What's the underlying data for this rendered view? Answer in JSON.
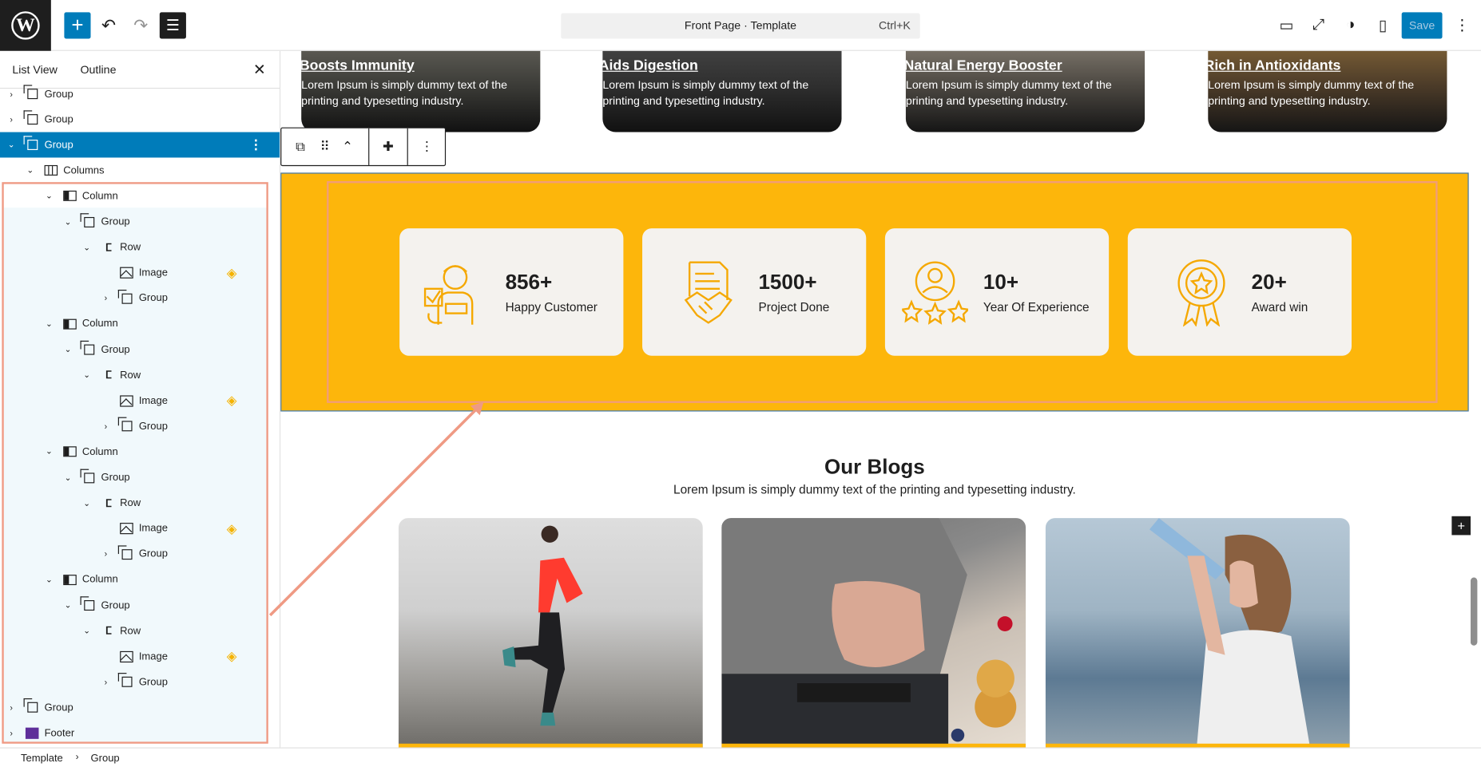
{
  "topbar": {
    "logo": "W",
    "add_icon": "+",
    "undo_icon": "↶",
    "redo_icon": "↷",
    "list_icon": "☰",
    "command_title": "Front Page · Template",
    "command_shortcut": "Ctrl+K",
    "save_label": "Save",
    "icons": [
      "desktop-icon",
      "fullscreen-icon",
      "contrast-icon",
      "sidebar-icon",
      "more-icon"
    ],
    "icon_glyphs": [
      "▭",
      "⤢",
      "◑",
      "▯",
      "⋮"
    ]
  },
  "sidebar": {
    "tabs": [
      "List View",
      "Outline"
    ],
    "close_icon": "✕",
    "rows": [
      {
        "label": "Group",
        "icon": "group",
        "chev": "›",
        "indent": 0
      },
      {
        "label": "Group",
        "icon": "group",
        "chev": "›",
        "indent": 0
      },
      {
        "label": "Group",
        "icon": "group",
        "chev": "⌄",
        "indent": 0,
        "selected": true
      },
      {
        "label": "Columns",
        "icon": "cols",
        "chev": "⌄",
        "indent": 1
      },
      {
        "label": "Column",
        "icon": "col",
        "chev": "⌄",
        "indent": 2
      },
      {
        "label": "Group",
        "icon": "group",
        "chev": "⌄",
        "indent": 3
      },
      {
        "label": "Row",
        "icon": "row",
        "chev": "⌄",
        "indent": 4
      },
      {
        "label": "Image",
        "icon": "img",
        "chev": "",
        "indent": 5,
        "thumb": true
      },
      {
        "label": "Group",
        "icon": "group",
        "chev": "›",
        "indent": 5
      },
      {
        "label": "Column",
        "icon": "col",
        "chev": "⌄",
        "indent": 2
      },
      {
        "label": "Group",
        "icon": "group",
        "chev": "⌄",
        "indent": 3
      },
      {
        "label": "Row",
        "icon": "row",
        "chev": "⌄",
        "indent": 4
      },
      {
        "label": "Image",
        "icon": "img",
        "chev": "",
        "indent": 5,
        "thumb": true
      },
      {
        "label": "Group",
        "icon": "group",
        "chev": "›",
        "indent": 5
      },
      {
        "label": "Column",
        "icon": "col",
        "chev": "⌄",
        "indent": 2
      },
      {
        "label": "Group",
        "icon": "group",
        "chev": "⌄",
        "indent": 3
      },
      {
        "label": "Row",
        "icon": "row",
        "chev": "⌄",
        "indent": 4
      },
      {
        "label": "Image",
        "icon": "img",
        "chev": "",
        "indent": 5,
        "thumb": true
      },
      {
        "label": "Group",
        "icon": "group",
        "chev": "›",
        "indent": 5
      },
      {
        "label": "Column",
        "icon": "col",
        "chev": "⌄",
        "indent": 2
      },
      {
        "label": "Group",
        "icon": "group",
        "chev": "⌄",
        "indent": 3
      },
      {
        "label": "Row",
        "icon": "row",
        "chev": "⌄",
        "indent": 4
      },
      {
        "label": "Image",
        "icon": "img",
        "chev": "",
        "indent": 5,
        "thumb": true
      },
      {
        "label": "Group",
        "icon": "group",
        "chev": "›",
        "indent": 5
      },
      {
        "label": "Group",
        "icon": "group",
        "chev": "›",
        "indent": 0
      },
      {
        "label": "Footer",
        "icon": "footer",
        "chev": "›",
        "indent": 0
      }
    ]
  },
  "breadcrumb": {
    "items": [
      "Template",
      "Group"
    ],
    "sep": "›"
  },
  "top_cards": [
    {
      "title": "Boosts Immunity",
      "desc": "Lorem Ipsum is simply dummy text of the printing and typesetting industry."
    },
    {
      "title": "Aids Digestion",
      "desc": "Lorem Ipsum is simply dummy text of the printing and typesetting industry."
    },
    {
      "title": "Natural Energy Booster",
      "desc": "Lorem Ipsum is simply dummy text of the printing and typesetting industry."
    },
    {
      "title": "Rich in Antioxidants",
      "desc": "Lorem Ipsum is simply dummy text of the printing and typesetting industry."
    }
  ],
  "block_toolbar": {
    "icons": [
      "⧉",
      "⠿",
      "⌃",
      "✚",
      "⋮"
    ]
  },
  "stats": [
    {
      "number": "856+",
      "label": "Happy Customer"
    },
    {
      "number": "1500+",
      "label": "Project Done"
    },
    {
      "number": "10+",
      "label": "Year Of Experience"
    },
    {
      "number": "20+",
      "label": "Award win"
    }
  ],
  "blogs": {
    "title": "Our Blogs",
    "subtitle": "Lorem Ipsum is simply dummy text of the printing and typesetting industry."
  },
  "colors": {
    "accent": "#007cba",
    "brand_yellow": "#fdb60b",
    "selection": "#ef9a84"
  }
}
